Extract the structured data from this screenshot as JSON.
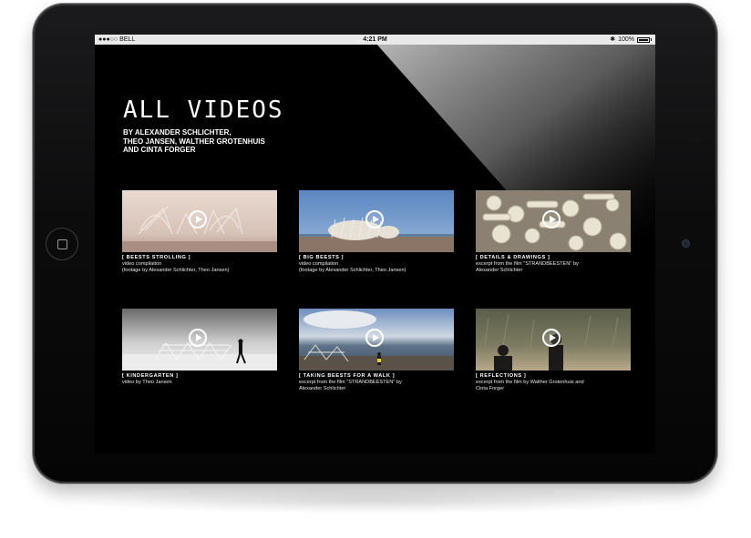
{
  "status_bar": {
    "carrier": "●●●○○ BELL",
    "time": "4:21 PM",
    "bluetooth": "✱",
    "battery_percent": "100%"
  },
  "page": {
    "title": "ALL VIDEOS",
    "byline": [
      "BY ALEXANDER SCHLICHTER,",
      "THEO JANSEN, WALTHER GROTENHUIS",
      "AND CINTA FORGER"
    ]
  },
  "videos": [
    {
      "title": "[ BEESTS STROLLING ]",
      "lines": [
        "video compilation",
        "(footage by Alexander Schlichter, Theo Jansen)"
      ]
    },
    {
      "title": "[ BIG BEESTS ]",
      "lines": [
        "video compilation",
        "(footage by Alexander Schlichter, Theo Jansen)"
      ]
    },
    {
      "title": "[ DETAILS & DRAWINGS ]",
      "lines": [
        "excerpt from the film \"STRANDBEESTEN\" by",
        "Alexander Schlichter"
      ]
    },
    {
      "title": "[ KINDERGARTEN ]",
      "lines": [
        "video by Theo Jansen",
        ""
      ]
    },
    {
      "title": "[ TAKING BEESTS FOR A WALK ]",
      "lines": [
        "excerpt from the film \"STRANDBEESTEN\" by",
        "Alexander Schlichter"
      ]
    },
    {
      "title": "[ REFLECTIONS ]",
      "lines": [
        "excerpt from the film by Walther Grotenhuis and",
        "Cinta Forger"
      ]
    }
  ]
}
